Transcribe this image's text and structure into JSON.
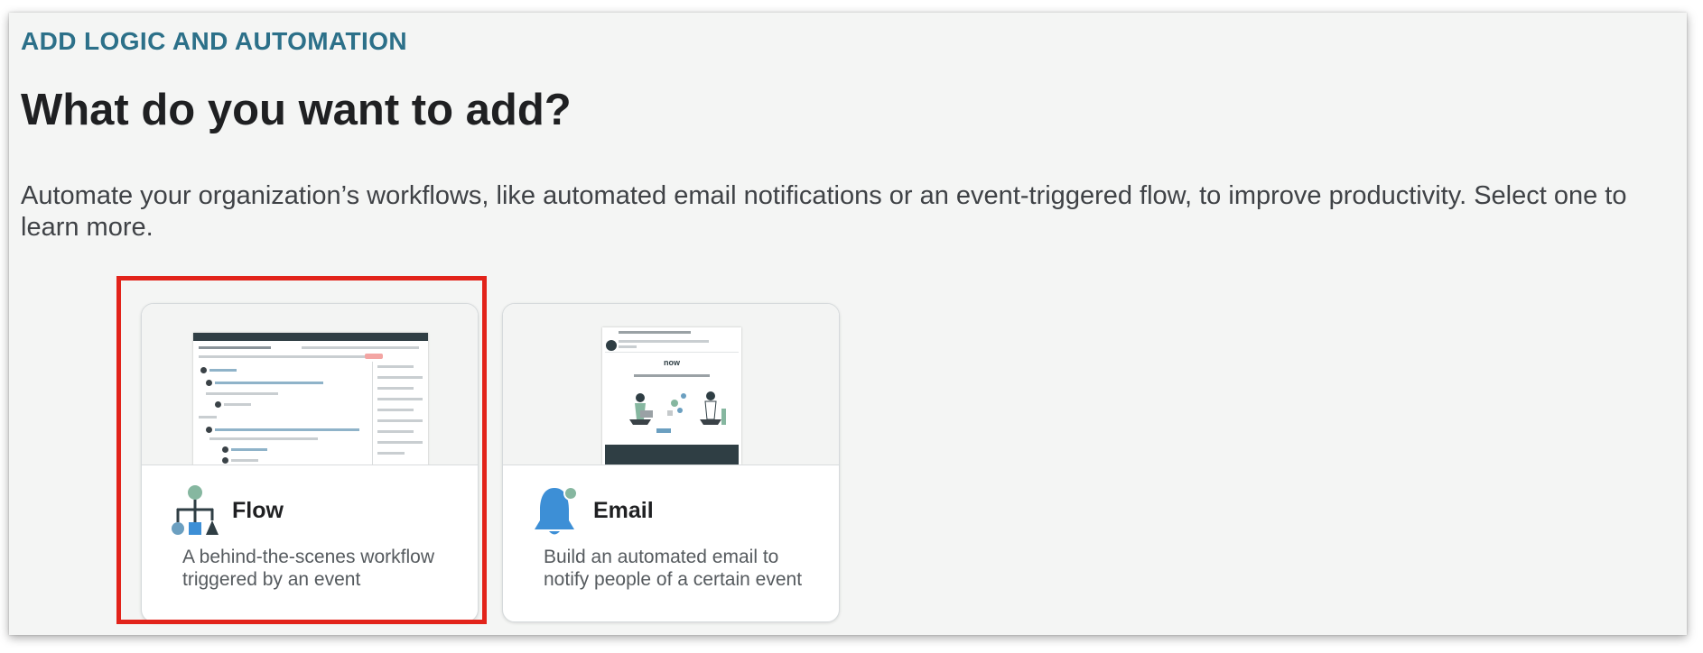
{
  "header": {
    "eyebrow": "ADD LOGIC AND AUTOMATION",
    "title": "What do you want to add?",
    "description": "Automate your organization’s workflows, like automated email notifications or an event-triggered flow, to improve productivity. Select one to learn more."
  },
  "options": [
    {
      "title": "Flow",
      "description": "A behind-the-scenes workflow triggered by an event",
      "icon": "flow-diagram-icon",
      "selected": true
    },
    {
      "title": "Email",
      "description": "Build an automated email to notify people of a certain event",
      "icon": "bell-icon",
      "selected": false
    }
  ],
  "colors": {
    "eyebrow": "#2c7089",
    "selection_outline": "#e2231a",
    "bell_blue": "#3d8fd6",
    "flow_green": "#86b7a0"
  }
}
